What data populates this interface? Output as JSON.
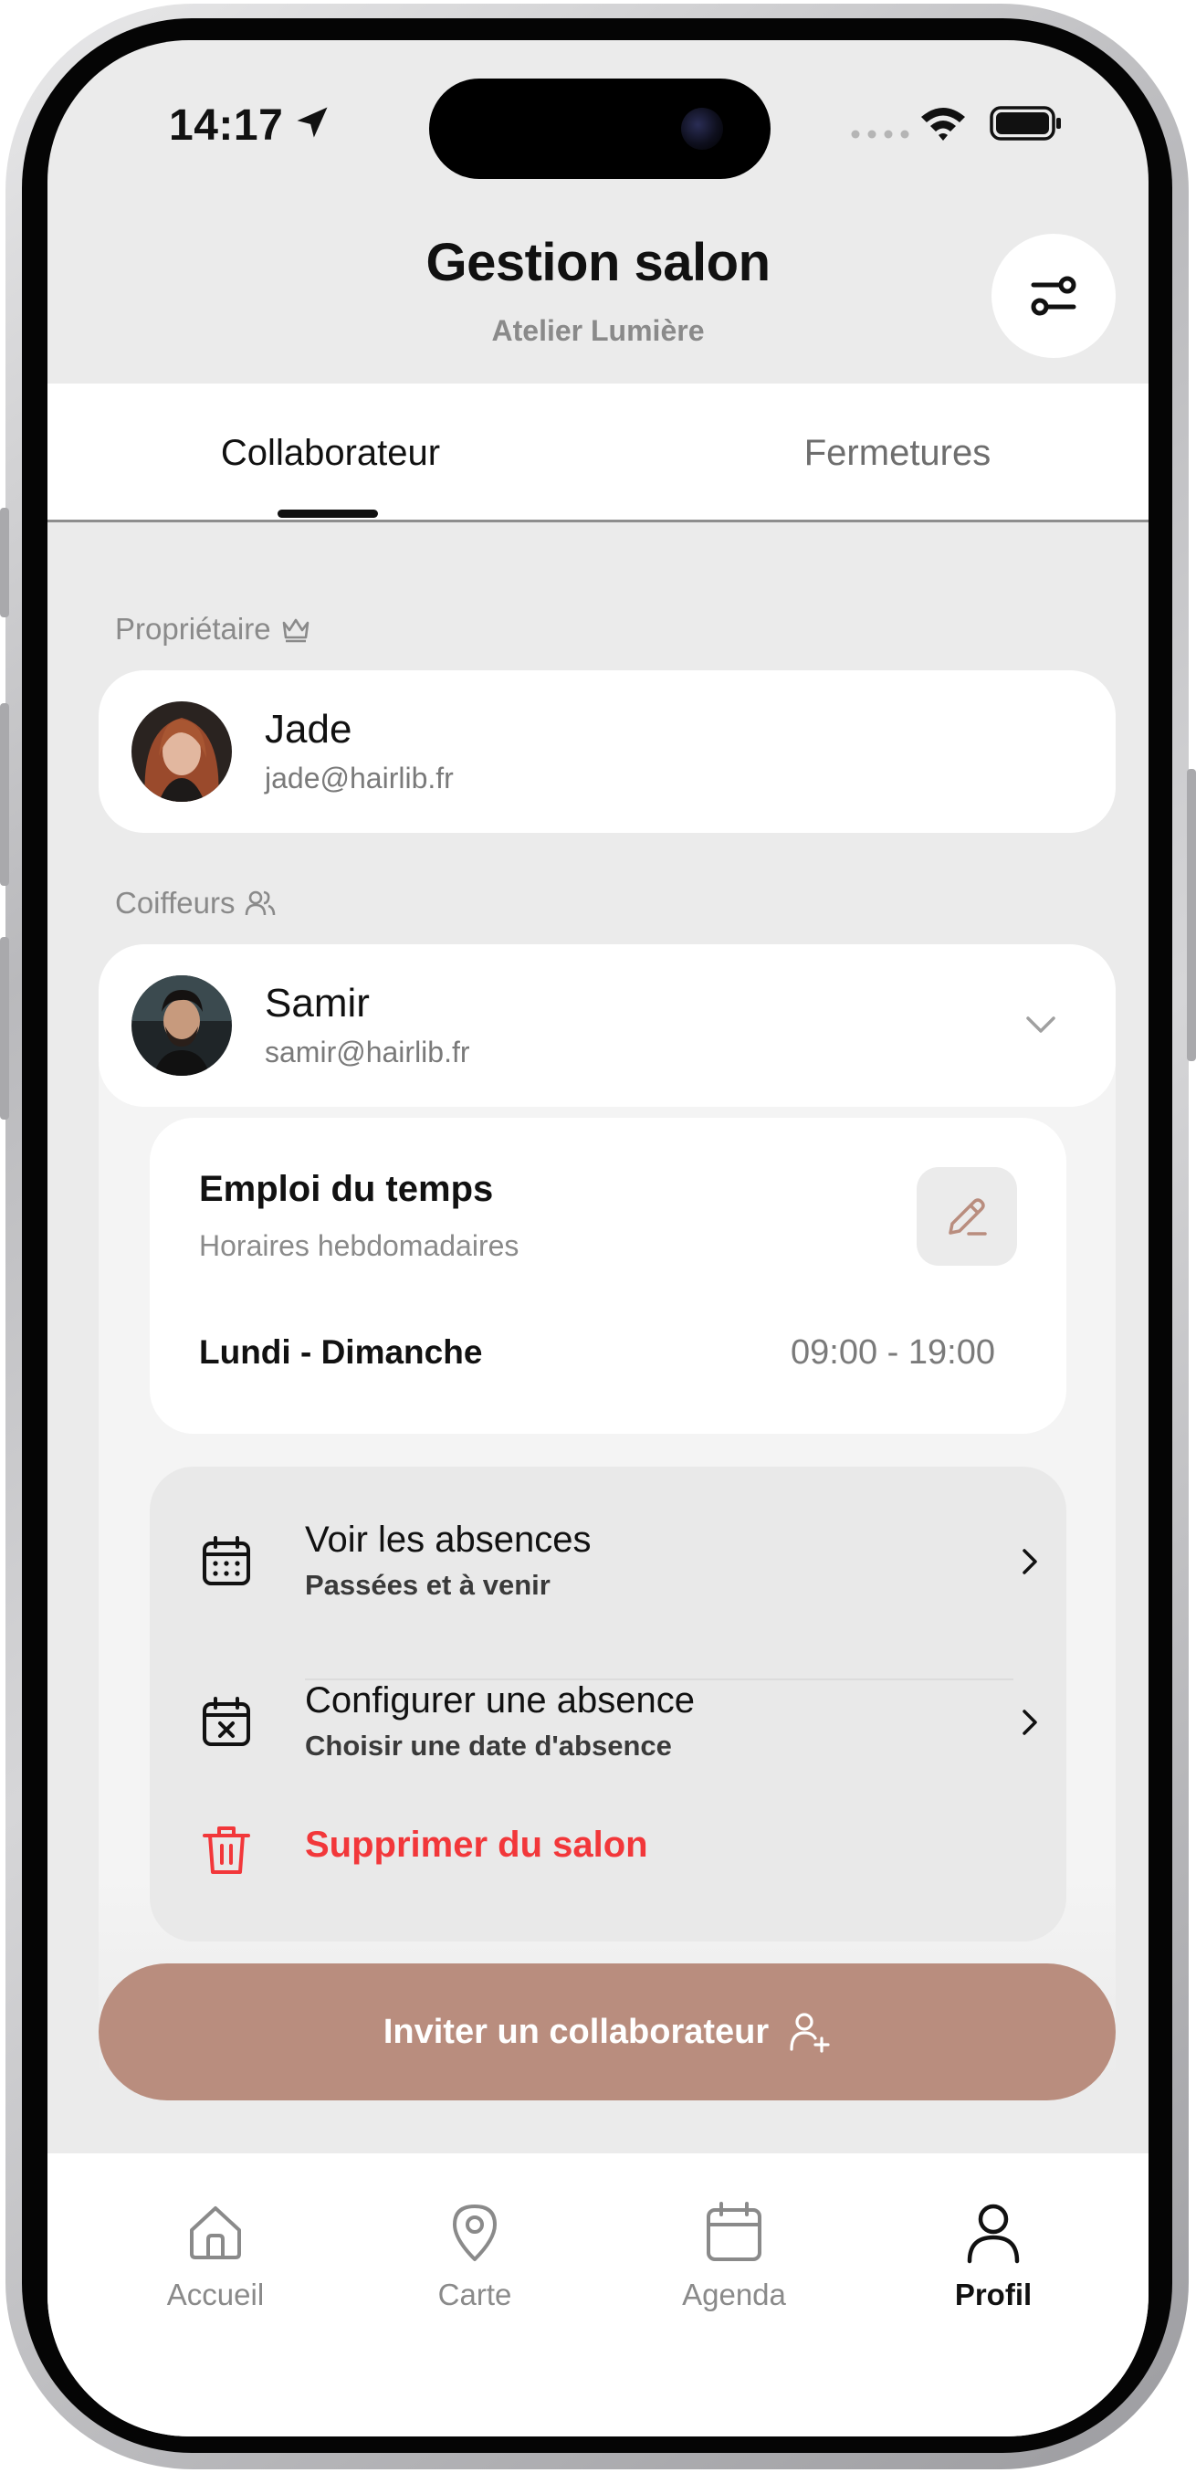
{
  "status_bar": {
    "time": "14:17"
  },
  "header": {
    "title": "Gestion salon",
    "subtitle": "Atelier Lumière"
  },
  "tabs": [
    {
      "label": "Collaborateur",
      "active": true
    },
    {
      "label": "Fermetures",
      "active": false
    }
  ],
  "owner_section": {
    "label": "Propriétaire",
    "person": {
      "name": "Jade",
      "email": "jade@hairlib.fr"
    }
  },
  "stylists_section": {
    "label": "Coiffeurs",
    "person": {
      "name": "Samir",
      "email": "samir@hairlib.fr",
      "expanded": true
    }
  },
  "schedule": {
    "title": "Emploi du temps",
    "subtitle": "Horaires hebdomadaires",
    "days": "Lundi - Dimanche",
    "hours": "09:00 - 19:00"
  },
  "actions": [
    {
      "title": "Voir les absences",
      "subtitle": "Passées et à venir",
      "icon": "calendar-grid-icon"
    },
    {
      "title": "Configurer une absence",
      "subtitle": "Choisir une date d'absence",
      "icon": "calendar-x-icon"
    }
  ],
  "delete_action": {
    "label": "Supprimer du salon",
    "icon": "trash-icon",
    "color": "#f2373a"
  },
  "invite_button": {
    "label": "Inviter un collaborateur",
    "icon": "user-plus-icon",
    "color": "#b98d7e"
  },
  "bottom_nav": [
    {
      "label": "Accueil",
      "icon": "home-icon",
      "active": false
    },
    {
      "label": "Carte",
      "icon": "map-pin-icon",
      "active": false
    },
    {
      "label": "Agenda",
      "icon": "calendar-icon",
      "active": false
    },
    {
      "label": "Profil",
      "icon": "user-icon",
      "active": true
    }
  ]
}
